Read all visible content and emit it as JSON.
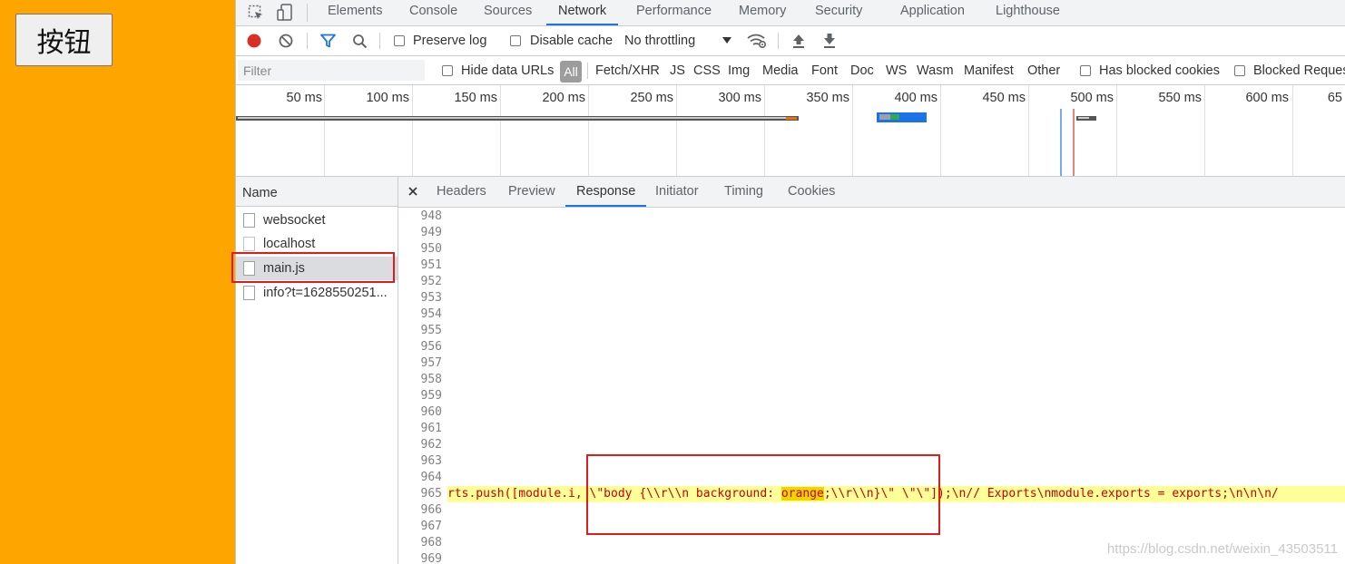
{
  "page": {
    "button_label": "按钮"
  },
  "devtools": {
    "main_tabs": [
      {
        "label": "Elements"
      },
      {
        "label": "Console"
      },
      {
        "label": "Sources"
      },
      {
        "label": "Network"
      },
      {
        "label": "Performance"
      },
      {
        "label": "Memory"
      },
      {
        "label": "Security"
      },
      {
        "label": "Application"
      },
      {
        "label": "Lighthouse"
      }
    ],
    "active_tab": "Network",
    "toolbar": {
      "preserve_log": "Preserve log",
      "disable_cache": "Disable cache",
      "throttling": "No throttling"
    },
    "filter": {
      "placeholder": "Filter",
      "hide_data_urls": "Hide data URLs",
      "types": [
        "All",
        "Fetch/XHR",
        "JS",
        "CSS",
        "Img",
        "Media",
        "Font",
        "Doc",
        "WS",
        "Wasm",
        "Manifest",
        "Other"
      ],
      "has_blocked_cookies": "Has blocked cookies",
      "blocked_requests": "Blocked Reques"
    },
    "overview_ticks": [
      "50 ms",
      "100 ms",
      "150 ms",
      "200 ms",
      "250 ms",
      "300 ms",
      "350 ms",
      "400 ms",
      "450 ms",
      "500 ms",
      "550 ms",
      "600 ms",
      "65"
    ],
    "requests": {
      "header": "Name",
      "items": [
        {
          "label": "websocket"
        },
        {
          "label": "localhost"
        },
        {
          "label": "main.js"
        },
        {
          "label": "info?t=1628550251..."
        }
      ],
      "selected": "main.js"
    },
    "detail_tabs": [
      {
        "label": "Headers"
      },
      {
        "label": "Preview"
      },
      {
        "label": "Response"
      },
      {
        "label": "Initiator"
      },
      {
        "label": "Timing"
      },
      {
        "label": "Cookies"
      }
    ],
    "active_detail_tab": "Response",
    "line_numbers": [
      "948",
      "949",
      "950",
      "951",
      "952",
      "953",
      "954",
      "955",
      "956",
      "957",
      "958",
      "959",
      "960",
      "961",
      "962",
      "963",
      "964",
      "965",
      "966",
      "967",
      "968",
      "969"
    ],
    "code": {
      "before": "rts.push([module.i, \\\"body {\\\\r\\\\n    background: ",
      "highlight": "orange",
      "after": ";\\\\r\\\\n}\\\"  \\\"\\\"]);\\n// Exports\\nmodule.exports = exports;\\n\\n\\n/"
    }
  },
  "watermark": "https://blog.csdn.net/weixin_43503511"
}
